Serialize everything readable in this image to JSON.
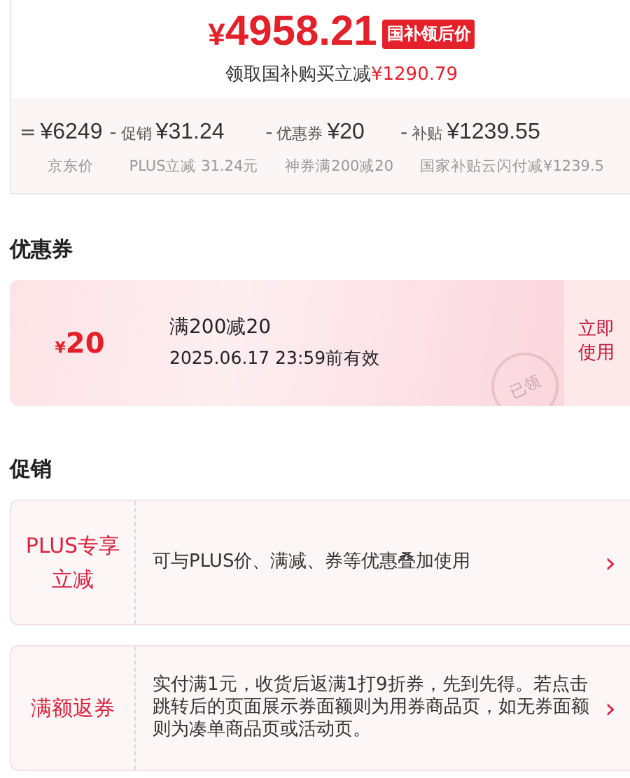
{
  "price": {
    "currency": "¥",
    "amount": "4958.21",
    "badge": "国补领后价",
    "subsidy_text": "领取国补购买立减",
    "subsidy_amount": "¥1290.79"
  },
  "breakdown": [
    {
      "op": "=",
      "amount": "¥6249",
      "note": "京东价"
    },
    {
      "op": "-",
      "label": "促销",
      "amount": "¥31.24",
      "note": "PLUS立减 31.24元"
    },
    {
      "op": "-",
      "label": "优惠券",
      "amount": "¥20",
      "note": "神券满200减20"
    },
    {
      "op": "-",
      "label": "补贴",
      "amount": "¥1239.55",
      "note": "国家补贴云闪付减¥1239.5"
    }
  ],
  "coupons_section": {
    "title": "优惠券",
    "coupons": [
      {
        "currency": "¥",
        "value": "20",
        "condition": "满200减20",
        "validity": "2025.06.17 23:59前有效",
        "claimed": true,
        "stamp": "已领",
        "action": "立即使用"
      }
    ]
  },
  "promotions_section": {
    "title": "促销",
    "items": [
      {
        "tag": "PLUS专享立减",
        "description": "可与PLUS价、满减、券等优惠叠加使用",
        "arrow": "›"
      },
      {
        "tag": "满额返券",
        "description": "实付满1元，收货后返满1打9折券，先到先得。若点击跳转后的页面展示券面额则为用券商品页，如无券面额则为凑单商品页或活动页。",
        "arrow": "›"
      }
    ]
  }
}
